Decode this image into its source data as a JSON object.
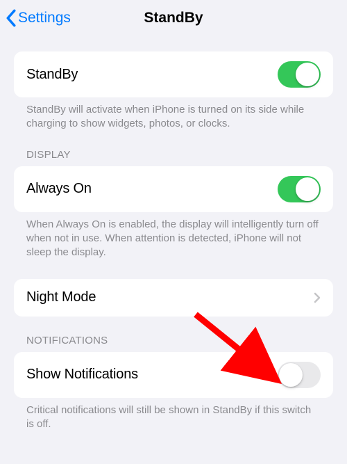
{
  "nav": {
    "back_label": "Settings",
    "title": "StandBy"
  },
  "rows": {
    "standby": {
      "label": "StandBy",
      "footer": "StandBy will activate when iPhone is turned on its side while charging to show widgets, photos, or clocks.",
      "toggle_on": true
    },
    "display_header": "DISPLAY",
    "always_on": {
      "label": "Always On",
      "footer": "When Always On is enabled, the display will intelligently turn off when not in use. When attention is detected, iPhone will not sleep the display.",
      "toggle_on": true
    },
    "night_mode": {
      "label": "Night Mode"
    },
    "notifications_header": "NOTIFICATIONS",
    "show_notifications": {
      "label": "Show Notifications",
      "footer": "Critical notifications will still be shown in StandBy if this switch is off.",
      "toggle_on": false
    }
  },
  "colors": {
    "tint": "#007aff",
    "toggle_on": "#34c759",
    "arrow": "#ff0000"
  }
}
